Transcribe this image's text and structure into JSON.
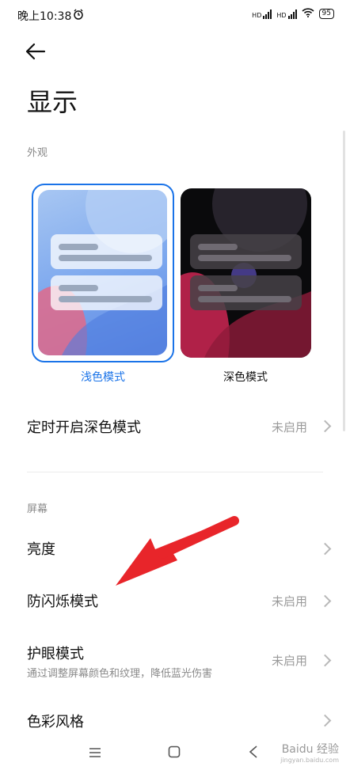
{
  "status_bar": {
    "time": "晚上10:38",
    "net1": "HD",
    "net2": "HD",
    "battery": "95"
  },
  "page_title": "显示",
  "appearance": {
    "section_label": "外观",
    "light_label": "浅色模式",
    "dark_label": "深色模式",
    "selected": "light"
  },
  "schedule_dark": {
    "title": "定时开启深色模式",
    "value": "未启用"
  },
  "screen": {
    "section_label": "屏幕",
    "items": [
      {
        "title": "亮度",
        "value": ""
      },
      {
        "title": "防闪烁模式",
        "value": "未启用"
      },
      {
        "title": "护眼模式",
        "value": "未启用",
        "subtitle": "通过调整屏幕颜色和纹理，降低蓝光伤害"
      },
      {
        "title": "色彩风格",
        "value": ""
      }
    ]
  },
  "watermark": {
    "text": "Baidu 经验",
    "sub": "jingyan.baidu.com"
  },
  "colors": {
    "accent": "#1a73e8",
    "annotation_arrow": "#e8252a"
  }
}
